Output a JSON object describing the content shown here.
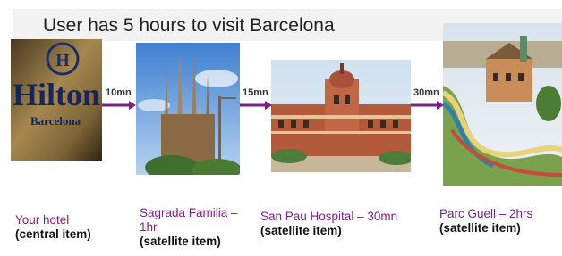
{
  "title": "User has 5 hours to visit Barcelona",
  "items": [
    {
      "id": "hotel",
      "name_lines": [
        "Your hotel"
      ],
      "role": "(central item)",
      "photo_text": [
        "Hilton",
        "Barcelona"
      ]
    },
    {
      "id": "sagrada",
      "name_lines": [
        "Sagrada Familia –",
        "1hr"
      ],
      "role": "(satellite item)"
    },
    {
      "id": "sanpau",
      "name_lines": [
        "San Pau Hospital – 30mn"
      ],
      "role": "(satellite item)"
    },
    {
      "id": "guell",
      "name_lines": [
        "Parc Guell – 2hrs"
      ],
      "role": "(satellite item)"
    }
  ],
  "arrows": [
    {
      "label": "10mn"
    },
    {
      "label": "15mn"
    },
    {
      "label": "30mn"
    }
  ],
  "colors": {
    "accent": "#7a1f86",
    "title_band": "#f2f2f2"
  }
}
